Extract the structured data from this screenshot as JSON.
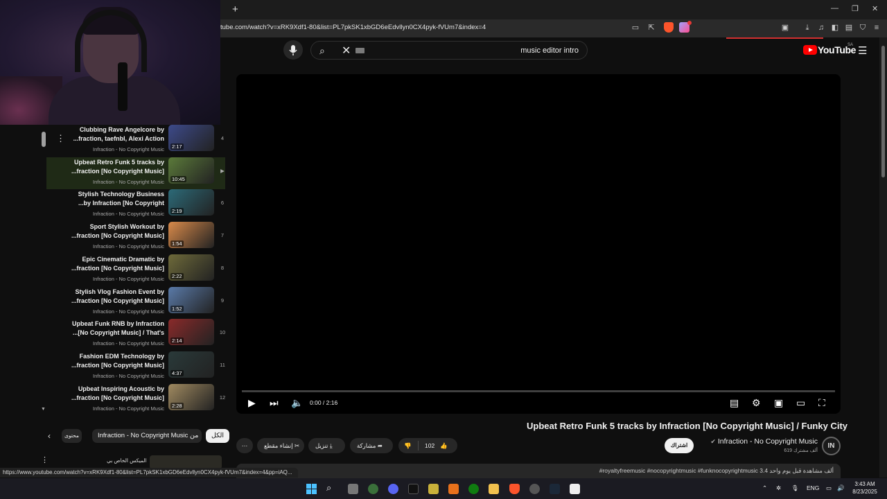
{
  "browser": {
    "url": "tube.com/watch?v=xRK9Xdf1-80&list=PL7pkSK1xbGD6eEdvllyn0CX4pyk-fVUm7&index=4",
    "new_tab": "+",
    "status_url": "https://www.youtube.com/watch?v=xRK9Xdf1-80&list=PL7pkSK1xbGD6eEdvllyn0CX4pyk-fVUm7&index=4&pp=iAQ..."
  },
  "youtube": {
    "logo_text": "YouTube",
    "country_code": "SA",
    "search_query": "music editor intro"
  },
  "player": {
    "time": "0:00 / 2:16",
    "progress": 0.0
  },
  "video": {
    "title": "Upbeat Retro Funk 5 tracks by Infraction [No Copyright Music] / Funky City",
    "channel": "Infraction - No Copyright Music",
    "channel_initials": "IN",
    "subscribers": "619 ألف مشترك",
    "subscribe_label": "اشتراك",
    "likes": "102",
    "share_label": "مشاركة",
    "download_label": "تنزيل",
    "clip_label": "إنشاء مقطع",
    "more_label": "⋯",
    "description": "#royaltyfreemusic #nocopyrightmusic #funknocopyrightmusic  3.4 ألف مشاهدة قبل يوم واحد"
  },
  "playlist": {
    "items": [
      {
        "line1": "Clubbing Rave Angelcore by",
        "line2": "...fraction, taefnbl, Alexi Action",
        "channel": "Infraction - No Copyright Music",
        "duration": "2:17",
        "index": "4",
        "active": false,
        "color": "#3d4a8a"
      },
      {
        "line1": "Upbeat Retro Funk 5 tracks by",
        "line2": "...fraction [No Copyright Music]",
        "channel": "Infraction - No Copyright Music",
        "duration": "10:45",
        "index": "▶",
        "active": true,
        "color": "#5b7a3a"
      },
      {
        "line1": "Stylish Technology Business",
        "line2": "...by Infraction [No Copyright",
        "channel": "Infraction - No Copyright Music",
        "duration": "2:19",
        "index": "6",
        "active": false,
        "color": "#2c6a78"
      },
      {
        "line1": "Sport Stylish Workout by",
        "line2": "...fraction [No Copyright Music]",
        "channel": "Infraction - No Copyright Music",
        "duration": "1:54",
        "index": "7",
        "active": false,
        "color": "#d98a4a"
      },
      {
        "line1": "Epic Cinematic Dramatic by",
        "line2": "...fraction [No Copyright Music]",
        "channel": "Infraction - No Copyright Music",
        "duration": "2:22",
        "index": "8",
        "active": false,
        "color": "#6e6a3a"
      },
      {
        "line1": "Stylish Vlog Fashion Event by",
        "line2": "...fraction [No Copyright Music]",
        "channel": "Infraction - No Copyright Music",
        "duration": "1:52",
        "index": "9",
        "active": false,
        "color": "#5a7aa8"
      },
      {
        "line1": "Upbeat Funk RNB by Infraction",
        "line2": "...[No Copyright Music] / That's",
        "channel": "Infraction - No Copyright Music",
        "duration": "2:14",
        "index": "10",
        "active": false,
        "color": "#8a2a2a"
      },
      {
        "line1": "Fashion EDM Technology by",
        "line2": "...fraction [No Copyright Music]",
        "channel": "Infraction - No Copyright Music",
        "duration": "4:37",
        "index": "11",
        "active": false,
        "color": "#2a3a3a"
      },
      {
        "line1": "Upbeat Inspiring Acoustic by",
        "line2": "...fraction [No Copyright Music]",
        "channel": "Infraction - No Copyright Music",
        "duration": "2:28",
        "index": "12",
        "active": false,
        "color": "#a08a60"
      }
    ]
  },
  "chips": {
    "all": "الكل",
    "from_channel": "Infraction - No Copyright Music من",
    "related": "محتوى"
  },
  "next_video_title": "الميكس الخاص بي",
  "clock": {
    "time": "3:43 AM",
    "date": "8/23/2025"
  },
  "tray": {
    "lang": "ENG"
  }
}
